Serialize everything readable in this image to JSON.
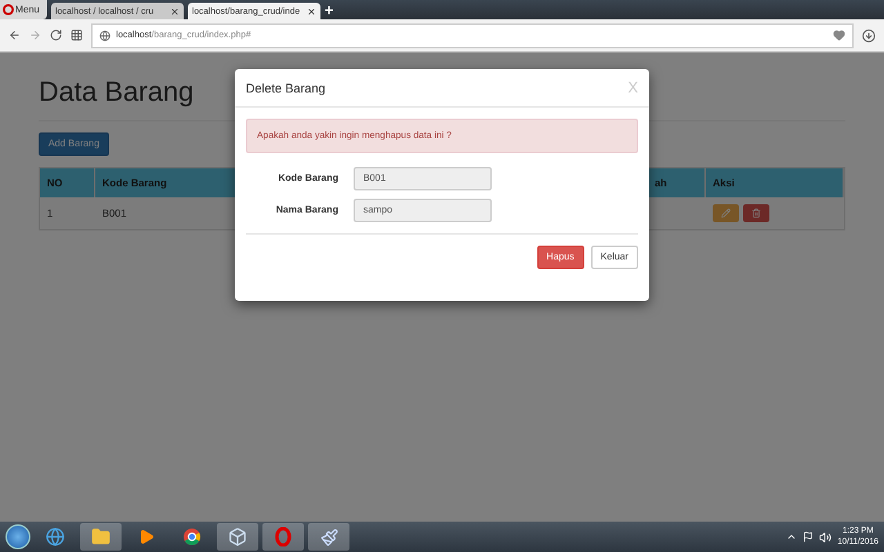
{
  "browser": {
    "menu_label": "Menu",
    "tabs": [
      {
        "title": "localhost / localhost / cru",
        "selected": false
      },
      {
        "title": "localhost/barang_crud/inde",
        "selected": true
      }
    ],
    "new_tab": "+",
    "address_host": "localhost",
    "address_path": "/barang_crud/index.php#"
  },
  "page": {
    "title": "Data Barang",
    "add_button": "Add Barang",
    "table": {
      "columns": [
        "NO",
        "Kode Barang",
        "ah",
        "Aksi"
      ],
      "rows": [
        {
          "cells": [
            "1",
            "B001"
          ]
        }
      ]
    }
  },
  "modal": {
    "title": "Delete Barang",
    "close": "X",
    "alert": "Apakah anda yakin ingin menghapus data ini ?",
    "fields": [
      {
        "label": "Kode Barang",
        "value": "B001"
      },
      {
        "label": "Nama Barang",
        "value": "sampo"
      }
    ],
    "buttons": [
      {
        "label": "Hapus",
        "kind": "danger"
      },
      {
        "label": "Keluar",
        "kind": "default"
      }
    ]
  },
  "taskbar": {
    "time": "1:23 PM",
    "date": "10/11/2016"
  }
}
